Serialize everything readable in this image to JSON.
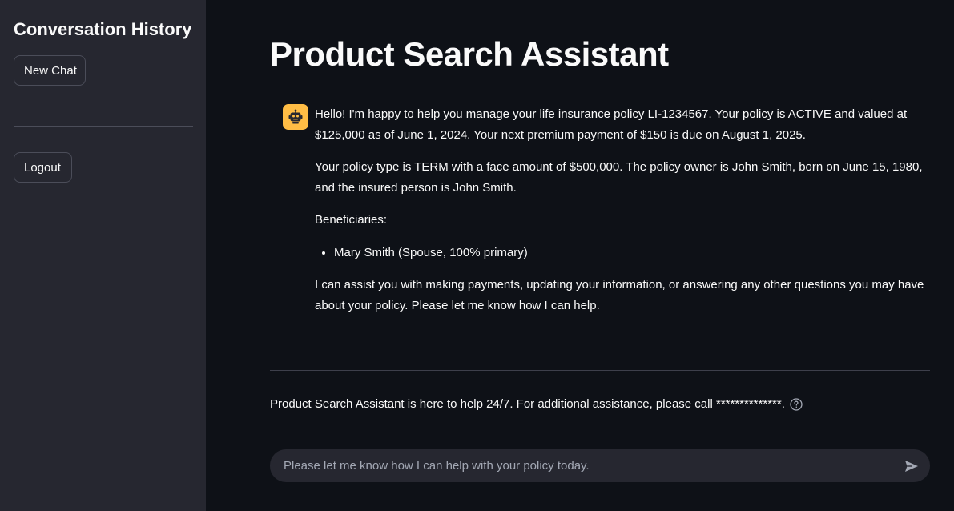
{
  "sidebar": {
    "title": "Conversation History",
    "new_chat_label": "New Chat",
    "logout_label": "Logout"
  },
  "main": {
    "title": "Product Search Assistant",
    "message": {
      "avatar_icon": "robot-icon",
      "paragraph_1": "Hello! I'm happy to help you manage your life insurance policy LI-1234567. Your policy is ACTIVE and valued at $125,000 as of June 1, 2024. Your next premium payment of $150 is due on August 1, 2025.",
      "paragraph_2": "Your policy type is TERM with a face amount of $500,000. The policy owner is John Smith, born on June 15, 1980, and the insured person is John Smith.",
      "beneficiaries_label": "Beneficiaries:",
      "beneficiaries": [
        "Mary Smith (Spouse, 100% primary)"
      ],
      "paragraph_3": "I can assist you with making payments, updating your information, or answering any other questions you may have about your policy. Please let me know how I can help."
    },
    "footer_note": "Product Search Assistant is here to help 24/7. For additional assistance, please call **************.",
    "chat_input": {
      "placeholder": "Please let me know how I can help with your policy today.",
      "value": ""
    }
  },
  "colors": {
    "background": "#0e1117",
    "sidebar": "#262730",
    "avatar": "#ffbd45",
    "text": "#fafafa",
    "placeholder": "#a3a8b4"
  },
  "icons": {
    "help": "question-circle-icon",
    "send": "send-icon"
  }
}
